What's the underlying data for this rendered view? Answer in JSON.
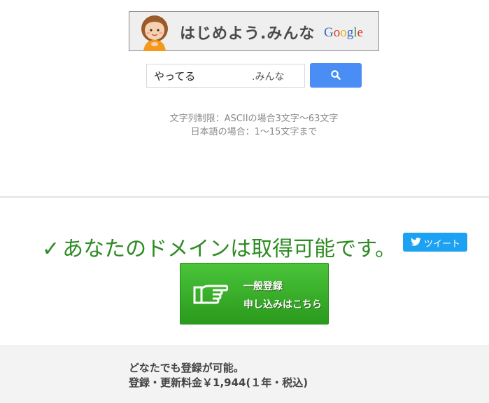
{
  "banner": {
    "brand_text": "はじめよう.みんな",
    "google_letters": [
      "G",
      "o",
      "o",
      "g",
      "l",
      "e"
    ]
  },
  "search": {
    "input_value": "やってる",
    "suffix": ".みんな",
    "button_icon": "search-icon"
  },
  "limits": {
    "line1": "文字列制限：ASCIIの場合3文字〜63文字",
    "line2": "日本語の場合：1〜15文字まで"
  },
  "result": {
    "check": "✓",
    "message": "あなたのドメインは取得可能です。",
    "tweet_label": "ツイート"
  },
  "register": {
    "line1": "一般登録",
    "line2": "申し込みはこちら"
  },
  "footer": {
    "line1": "どなたでも登録が可能。",
    "line2": "登録・更新料金￥1,944(１年・税込)"
  },
  "colors": {
    "search_button": "#4a8ef5",
    "available_text": "#2e8b23",
    "tweet_button": "#1da1f2",
    "register_button": "#3aaf2b"
  }
}
